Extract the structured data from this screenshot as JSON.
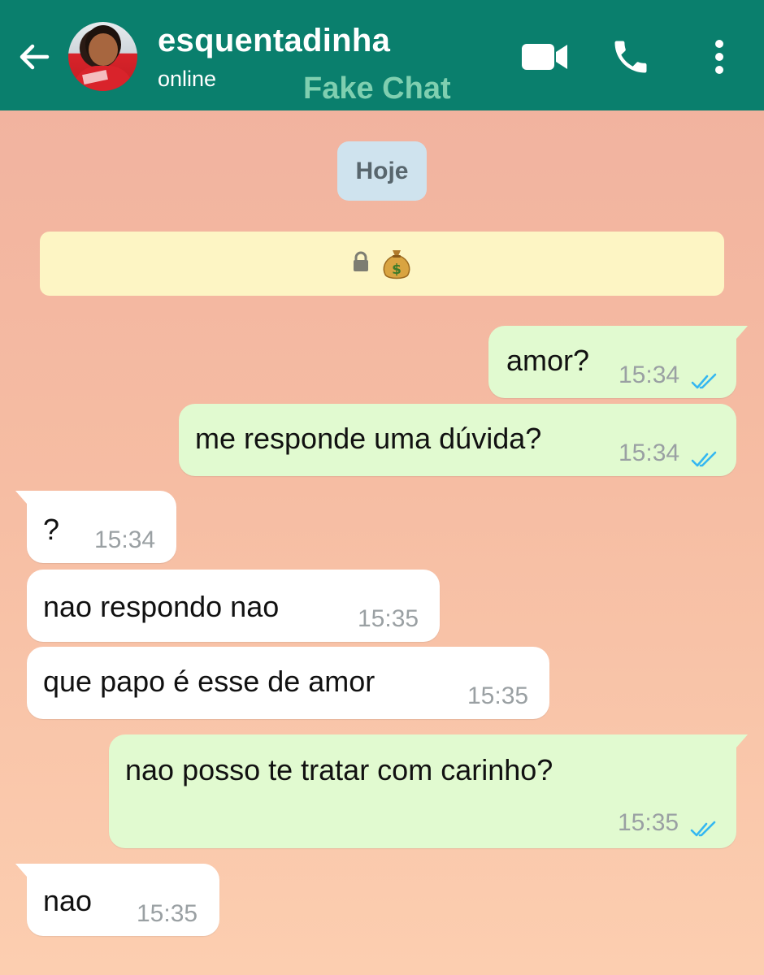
{
  "header": {
    "contact_name": "esquentadinha",
    "status": "online",
    "watermark": "Fake Chat",
    "icons": {
      "back": "arrow-left-icon",
      "video": "video-call-icon",
      "phone": "phone-call-icon",
      "more": "more-vert-icon"
    },
    "colors": {
      "bar": "#0a7f6d",
      "watermark": "#7fcfb0"
    }
  },
  "date_chip": "Hoje",
  "notice": {
    "icons": [
      "lock-icon",
      "money-bag-icon"
    ]
  },
  "messages": [
    {
      "direction": "out",
      "text": "amor?",
      "time": "15:34",
      "status": "read"
    },
    {
      "direction": "out",
      "text": "me responde uma dúvida?",
      "time": "15:34",
      "status": "read"
    },
    {
      "direction": "in",
      "text": "?",
      "time": "15:34"
    },
    {
      "direction": "in",
      "text": "nao respondo nao",
      "time": "15:35"
    },
    {
      "direction": "in",
      "text": "que papo é esse de amor",
      "time": "15:35"
    },
    {
      "direction": "out",
      "text": "nao posso te tratar com carinho?",
      "time": "15:35",
      "status": "read"
    },
    {
      "direction": "in",
      "text": "nao",
      "time": "15:35"
    }
  ],
  "colors": {
    "outgoing_bubble": "#e1fad0",
    "incoming_bubble": "#ffffff",
    "read_ticks": "#34b7f1",
    "notice_bg": "#fdf5c4",
    "date_chip_bg": "#cfe3ee"
  }
}
